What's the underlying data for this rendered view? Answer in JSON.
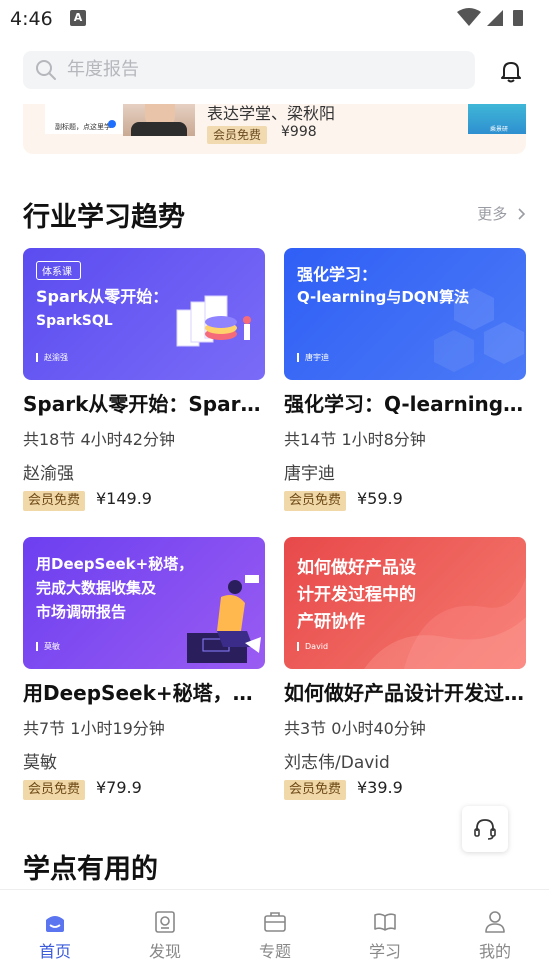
{
  "status_bar": {
    "time": "4:46",
    "app_icon": "A"
  },
  "search": {
    "placeholder": "年度报告"
  },
  "banner": {
    "left_caption": "副标题，点这里学",
    "title": "表达学堂、梁秋阳",
    "tag": "会员免费",
    "price": "¥998",
    "right_caption": "乘景研"
  },
  "section_trend": {
    "title": "行业学习趋势",
    "more": "更多"
  },
  "courses": [
    {
      "cover_badge": "体系课",
      "cover_lines": [
        "Spark从零开始：",
        "SparkSQL"
      ],
      "cover_author": "赵渝强",
      "title": "Spark从零开始：SparkSQL",
      "meta": "共18节   4小时42分钟",
      "author": "赵渝强",
      "tag": "会员免费",
      "price": "¥149.9",
      "color_a": "#5b4cf0",
      "color_b": "#7a6cf7"
    },
    {
      "cover_lines": [
        "强化学习：",
        "Q-learning与DQN算法"
      ],
      "cover_author": "唐宇迪",
      "title": "强化学习：Q-learning与DQN算法",
      "meta": "共14节   1小时8分钟",
      "author": "唐宇迪",
      "tag": "会员免费",
      "price": "¥59.9",
      "color_a": "#2f5ff5",
      "color_b": "#4c7af7"
    },
    {
      "cover_lines": [
        "用DeepSeek+秘塔，",
        "完成大数据收集及",
        "市场调研报告"
      ],
      "cover_author": "莫敏",
      "title": "用DeepSeek+秘塔，完成大数据收集及市场调研报告",
      "meta": "共7节   1小时19分钟",
      "author": "莫敏",
      "tag": "会员免费",
      "price": "¥79.9",
      "color_a": "#6c3ff0",
      "color_b": "#9a5cf2"
    },
    {
      "cover_lines": [
        "如何做好产品设",
        "计开发过程中的",
        "产研协作"
      ],
      "cover_author": "David",
      "title": "如何做好产品设计开发过程中的产研协作",
      "meta": "共3节   0小时40分钟",
      "author": "刘志伟/David",
      "tag": "会员免费",
      "price": "¥39.9",
      "color_a": "#e8494a",
      "color_b": "#f47a6e"
    }
  ],
  "section_useful": {
    "title": "学点有用的"
  },
  "tabs": [
    {
      "label": "首页",
      "icon": "home-icon",
      "active": true
    },
    {
      "label": "发现",
      "icon": "discover-icon",
      "active": false
    },
    {
      "label": "专题",
      "icon": "topic-icon",
      "active": false
    },
    {
      "label": "学习",
      "icon": "study-icon",
      "active": false
    },
    {
      "label": "我的",
      "icon": "profile-icon",
      "active": false
    }
  ],
  "colors": {
    "accent": "#3b5bdb",
    "tag_bg": "#f0d8a8"
  }
}
